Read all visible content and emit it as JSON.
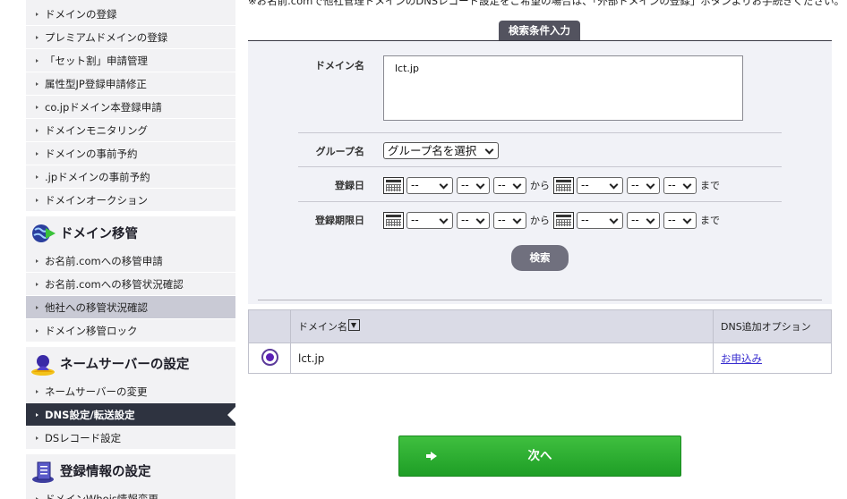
{
  "sidebar": {
    "group1": [
      "ドメインの登録",
      "プレミアムドメインの登録",
      "「セット割」申請管理",
      "属性型JP登録申請修正",
      "co.jpドメイン本登録申請",
      "ドメインモニタリング",
      "ドメインの事前予約",
      ".jpドメインの事前予約",
      "ドメインオークション"
    ],
    "section_transfer": {
      "title": "ドメイン移管",
      "icon": "globe-transfer-icon"
    },
    "group2": [
      "お名前.comへの移管申請",
      "お名前.comへの移管状況確認",
      "他社への移管状況確認",
      "ドメイン移管ロック"
    ],
    "section_nameserver": {
      "title": "ネームサーバーの設定",
      "icon": "server-user-icon"
    },
    "group3": [
      "ネームサーバーの変更",
      "DNS設定/転送設定",
      "DSレコード設定"
    ],
    "section_registration": {
      "title": "登録情報の設定",
      "icon": "document-icon"
    },
    "group4": [
      "ドメインWhois情報変更"
    ]
  },
  "notice": "※お名前.comで他社管理ドメインのDNSレコード設定をご希望の場合は、「外部ドメインの登録」ボタンよりお手続きください。",
  "search": {
    "tab_label": "検索条件入力",
    "domain_label": "ドメイン名",
    "domain_value": "lct.jp",
    "group_label": "グループ名",
    "group_selected": "グループ名を選択",
    "reg_date_label": "登録日",
    "expire_date_label": "登録期限日",
    "date_placeholder": "--",
    "from_text": "から",
    "to_text": "まで",
    "search_button": "検索"
  },
  "table": {
    "headers": [
      "",
      "ドメイン名",
      "DNS追加オプション"
    ],
    "rows": [
      {
        "domain": "lct.jp",
        "option_link": "お申込み"
      }
    ]
  },
  "next_button": "次へ",
  "colors": {
    "sidebar_active": "#2e3340",
    "sidebar_hover": "#c9cad5",
    "panel_bg": "#f1f2f7",
    "next_green": "#1e9e26",
    "link": "#3a2fd0"
  }
}
